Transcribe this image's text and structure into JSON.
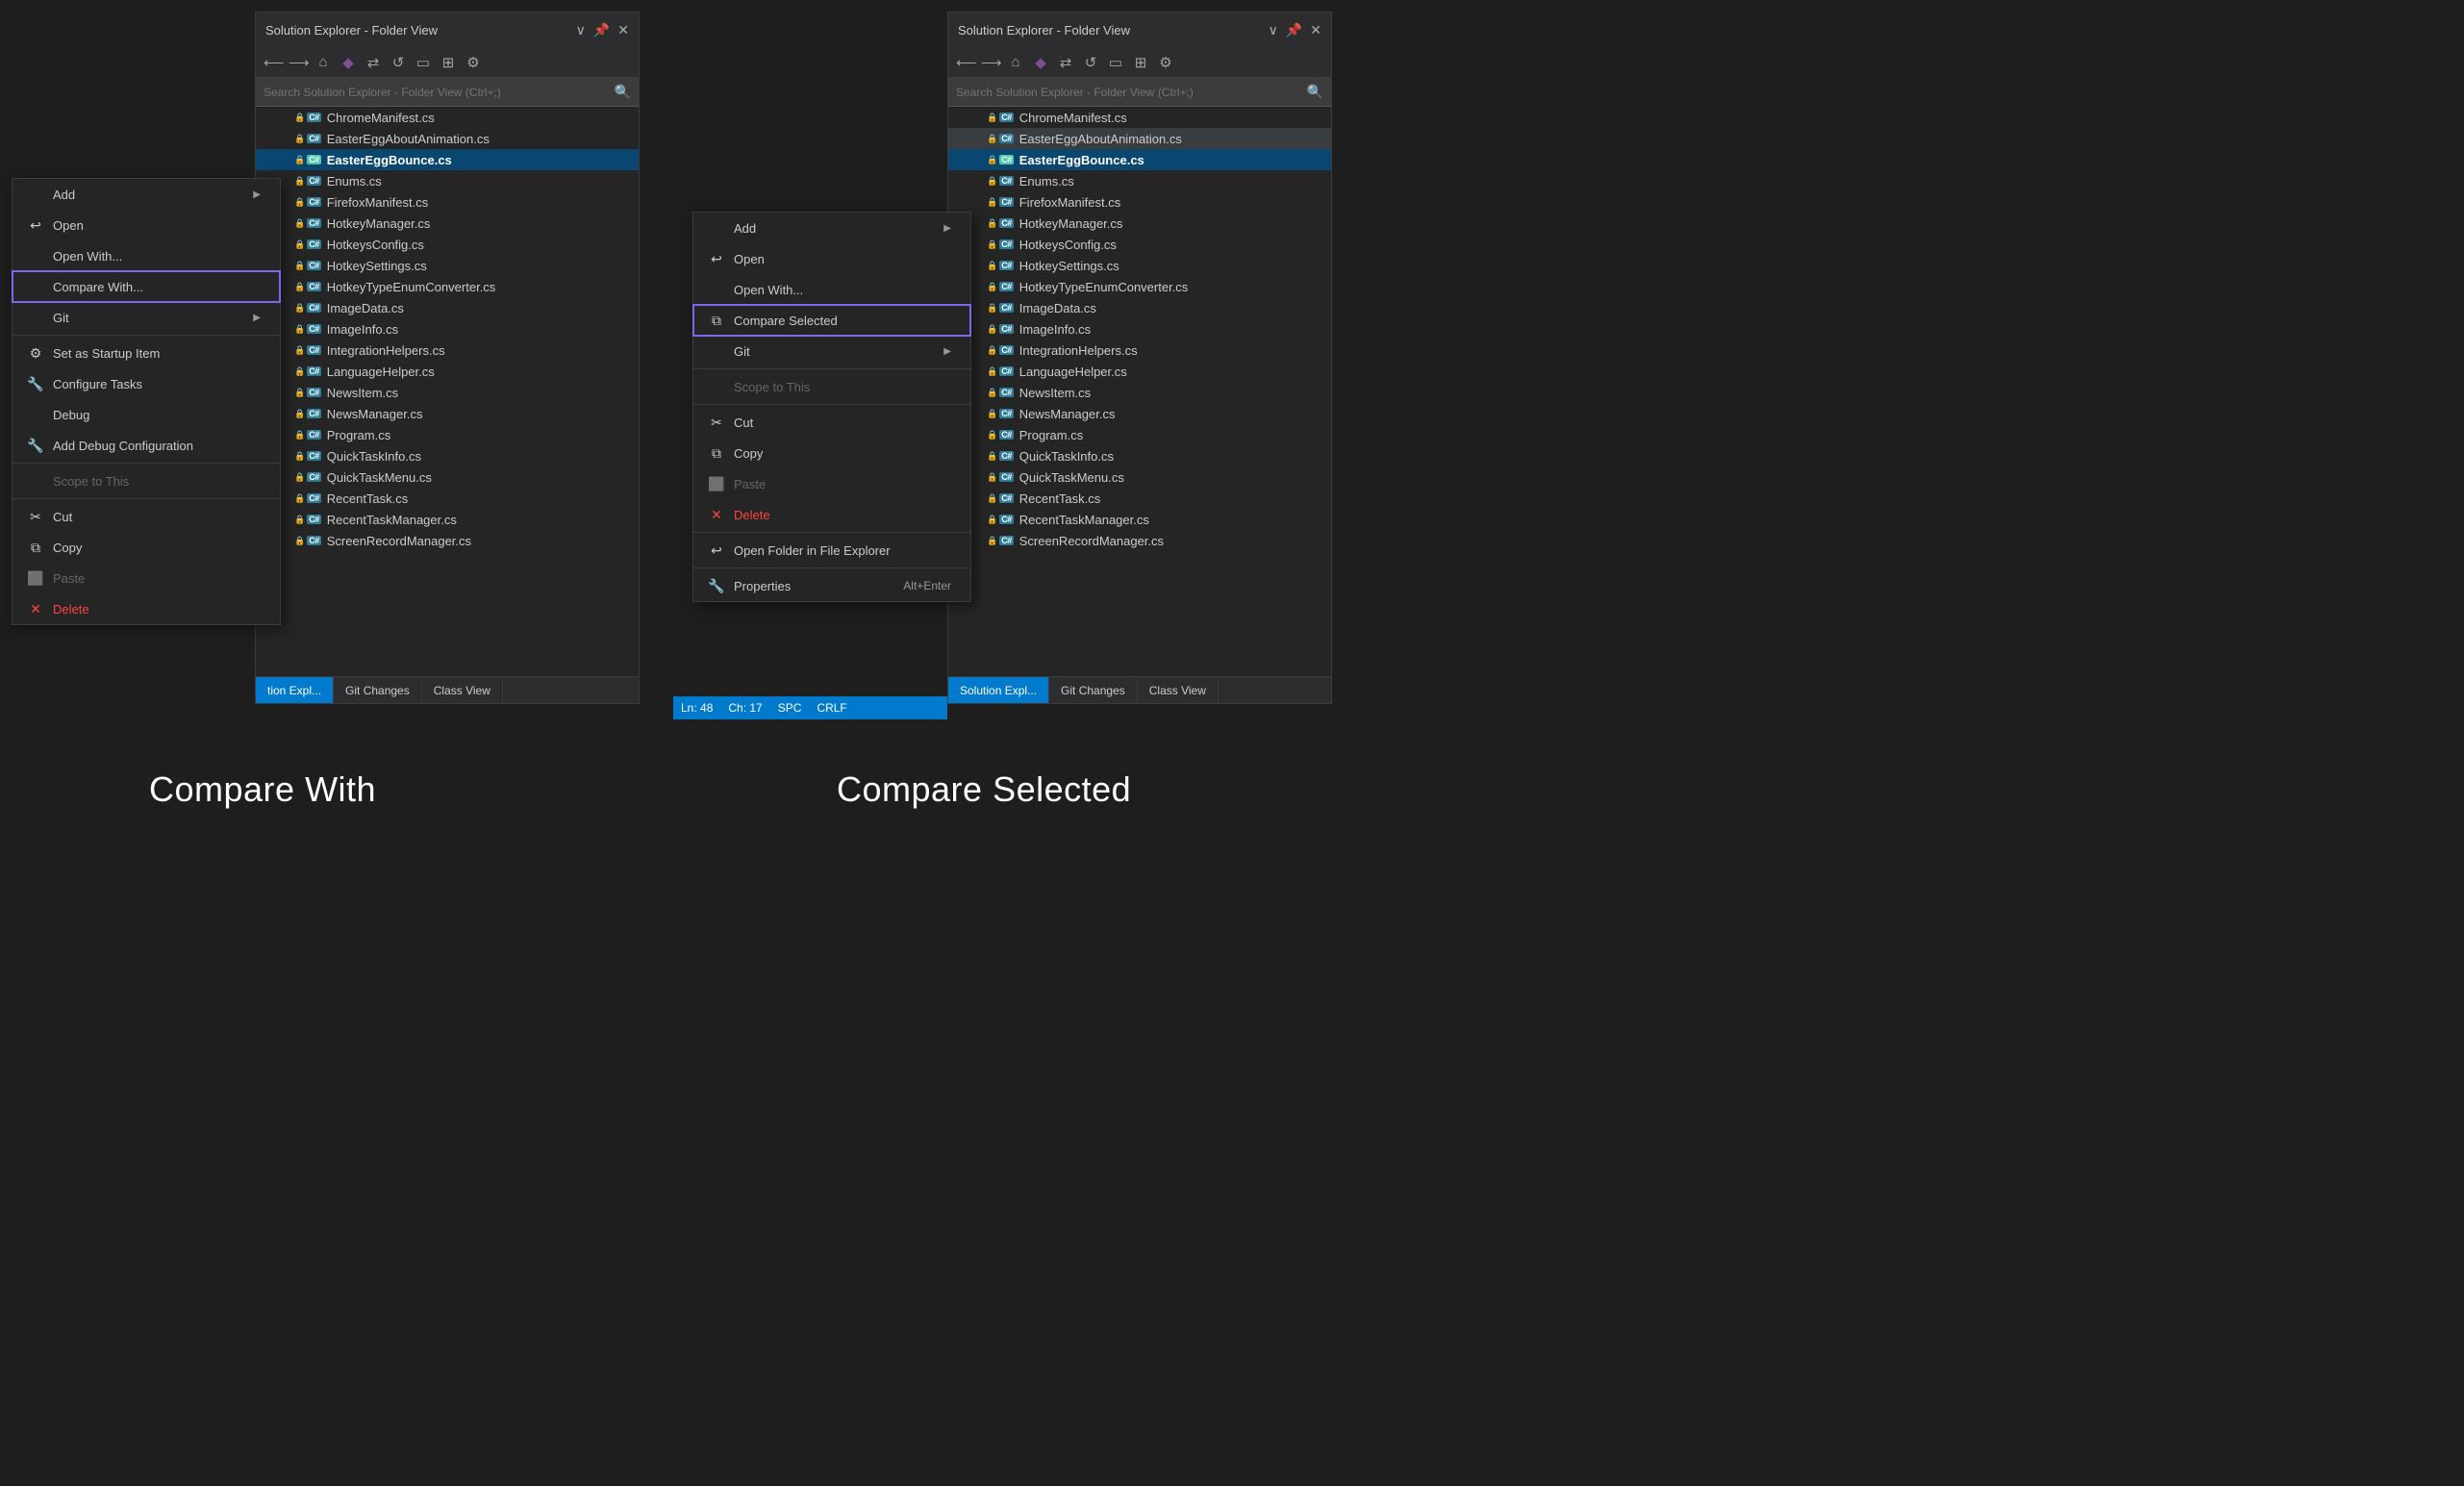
{
  "background": "#1e1e1e",
  "panels": {
    "left": {
      "title": "Solution Explorer - Folder View",
      "search_placeholder": "Search Solution Explorer - Folder View (Ctrl+;)",
      "files": [
        "ChromeManifest.cs",
        "EasterEggAboutAnimation.cs",
        "EasterEggBounce.cs",
        "Enums.cs",
        "FirefoxManifest.cs",
        "HotkeyManager.cs",
        "HotkeysConfig.cs",
        "HotkeySettings.cs",
        "HotkeyTypeEnumConverter.cs",
        "ImageData.cs",
        "ImageInfo.cs",
        "IntegrationHelpers.cs",
        "LanguageHelper.cs",
        "NewsItem.cs",
        "NewsManager.cs",
        "Program.cs",
        "QuickTaskInfo.cs",
        "QuickTaskMenu.cs",
        "RecentTask.cs",
        "RecentTaskManager.cs",
        "ScreenRecordManager.cs"
      ],
      "highlighted_file": "EasterEggBounce.cs",
      "tabs": [
        "tion Expl...",
        "Git Changes",
        "Class View"
      ]
    },
    "right": {
      "title": "Solution Explorer - Folder View",
      "search_placeholder": "Search Solution Explorer - Folder View (Ctrl+;)",
      "files": [
        "ChromeManifest.cs",
        "EasterEggAboutAnimation.cs",
        "EasterEggBounce.cs",
        "Enums.cs",
        "FirefoxManifest.cs",
        "HotkeyManager.cs",
        "HotkeysConfig.cs",
        "HotkeySettings.cs",
        "HotkeyTypeEnumConverter.cs",
        "ImageData.cs",
        "ImageInfo.cs",
        "IntegrationHelpers.cs",
        "LanguageHelper.cs",
        "NewsItem.cs",
        "NewsManager.cs",
        "Program.cs",
        "QuickTaskInfo.cs",
        "QuickTaskMenu.cs",
        "RecentTask.cs",
        "RecentTaskManager.cs",
        "ScreenRecordManager.cs"
      ],
      "highlighted_file": "EasterEggBounce.cs",
      "selected_file": "EasterEggAboutAnimation.cs",
      "tabs": [
        "Solution Expl...",
        "Git Changes",
        "Class View"
      ],
      "status": {
        "ln": "Ln: 48",
        "ch": "Ch: 17",
        "enc": "SPC",
        "eol": "CRLF"
      }
    }
  },
  "context_menu_left": {
    "items": [
      {
        "id": "add",
        "label": "Add",
        "has_arrow": true,
        "icon": "",
        "disabled": false
      },
      {
        "id": "open",
        "label": "Open",
        "has_arrow": false,
        "icon": "↩",
        "disabled": false
      },
      {
        "id": "open-with",
        "label": "Open With...",
        "has_arrow": false,
        "icon": "",
        "disabled": false
      },
      {
        "id": "compare-with",
        "label": "Compare With...",
        "has_arrow": false,
        "icon": "",
        "disabled": false,
        "highlighted": true
      },
      {
        "id": "git",
        "label": "Git",
        "has_arrow": true,
        "icon": "",
        "disabled": false
      },
      {
        "id": "sep1",
        "separator": true
      },
      {
        "id": "set-startup",
        "label": "Set as Startup Item",
        "has_arrow": false,
        "icon": "⚙",
        "disabled": false
      },
      {
        "id": "configure-tasks",
        "label": "Configure Tasks",
        "has_arrow": false,
        "icon": "🔧",
        "disabled": false
      },
      {
        "id": "debug",
        "label": "Debug",
        "has_arrow": false,
        "icon": "",
        "disabled": false
      },
      {
        "id": "add-debug",
        "label": "Add Debug Configuration",
        "has_arrow": false,
        "icon": "🔧",
        "disabled": false
      },
      {
        "id": "sep2",
        "separator": true
      },
      {
        "id": "scope-to-this",
        "label": "Scope to This",
        "has_arrow": false,
        "icon": "",
        "disabled": true
      },
      {
        "id": "sep3",
        "separator": true
      },
      {
        "id": "cut",
        "label": "Cut",
        "has_arrow": false,
        "icon": "✂",
        "disabled": false
      },
      {
        "id": "copy",
        "label": "Copy",
        "has_arrow": false,
        "icon": "⧉",
        "disabled": false
      },
      {
        "id": "paste",
        "label": "Paste",
        "has_arrow": false,
        "icon": "⬜",
        "disabled": true
      },
      {
        "id": "delete",
        "label": "Delete",
        "has_arrow": false,
        "icon": "✕",
        "disabled": false,
        "red": true
      }
    ]
  },
  "context_menu_right": {
    "items": [
      {
        "id": "add",
        "label": "Add",
        "has_arrow": true,
        "icon": "",
        "disabled": false
      },
      {
        "id": "open",
        "label": "Open",
        "has_arrow": false,
        "icon": "↩",
        "disabled": false
      },
      {
        "id": "open-with",
        "label": "Open With...",
        "has_arrow": false,
        "icon": "",
        "disabled": false
      },
      {
        "id": "compare-selected",
        "label": "Compare Selected",
        "has_arrow": false,
        "icon": "⧉",
        "disabled": false,
        "highlighted": true
      },
      {
        "id": "git",
        "label": "Git",
        "has_arrow": true,
        "icon": "",
        "disabled": false
      },
      {
        "id": "sep1",
        "separator": true
      },
      {
        "id": "scope-to-this",
        "label": "Scope to This",
        "has_arrow": false,
        "icon": "",
        "disabled": true
      },
      {
        "id": "sep2",
        "separator": true
      },
      {
        "id": "cut",
        "label": "Cut",
        "has_arrow": false,
        "icon": "✂",
        "disabled": false
      },
      {
        "id": "copy",
        "label": "Copy",
        "has_arrow": false,
        "icon": "⧉",
        "disabled": false
      },
      {
        "id": "paste",
        "label": "Paste",
        "has_arrow": false,
        "icon": "⬜",
        "disabled": true
      },
      {
        "id": "delete",
        "label": "Delete",
        "has_arrow": false,
        "icon": "✕",
        "disabled": false,
        "red": true
      },
      {
        "id": "sep3",
        "separator": true
      },
      {
        "id": "open-folder",
        "label": "Open Folder in File Explorer",
        "has_arrow": false,
        "icon": "↩",
        "disabled": false
      },
      {
        "id": "sep4",
        "separator": true
      },
      {
        "id": "properties",
        "label": "Properties",
        "has_arrow": false,
        "icon": "🔧",
        "disabled": false,
        "shortcut": "Alt+Enter"
      }
    ]
  },
  "bottom_labels": {
    "left": "Compare With",
    "right": "Compare Selected"
  }
}
